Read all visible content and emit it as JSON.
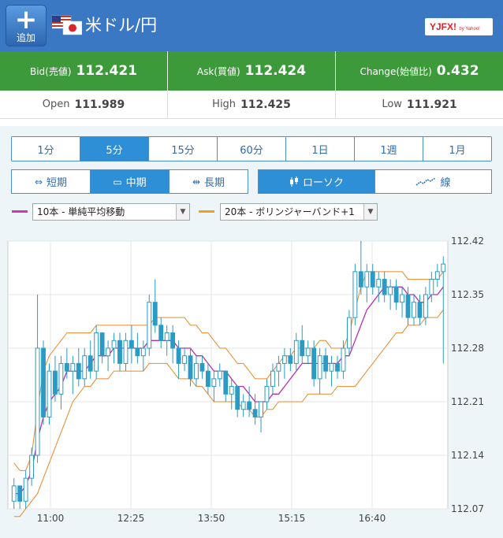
{
  "header": {
    "add_label": "追加",
    "pair_title": "米ドル/円",
    "logo_text": "YJFX!",
    "logo_sub": "by Yahoo!"
  },
  "prices": {
    "bid_label": "Bid(売値)",
    "bid_main": "112.42",
    "bid_last": "1",
    "ask_label": "Ask(買値)",
    "ask_main": "112.42",
    "ask_last": "4",
    "change_label": "Change(始値比)",
    "change_value": "0.432"
  },
  "ohl": {
    "open_label": "Open",
    "open_value": "111.989",
    "high_label": "High",
    "high_value": "112.425",
    "low_label": "Low",
    "low_value": "111.921"
  },
  "timeframes": [
    "1分",
    "5分",
    "15分",
    "60分",
    "1日",
    "1週",
    "1月"
  ],
  "active_timeframe": 1,
  "periods": [
    {
      "label": "短期",
      "icon": "↔"
    },
    {
      "label": "中期",
      "icon": "▭"
    },
    {
      "label": "長期",
      "icon": "↔"
    }
  ],
  "active_period": 1,
  "chart_types": [
    {
      "label": "ローソク",
      "icon": "candle-icon"
    },
    {
      "label": "線",
      "icon": "line-icon"
    }
  ],
  "active_chart_type": 0,
  "indicators": {
    "ind1": {
      "label": "10本 - 単純平均移動",
      "color": "#c43bb5"
    },
    "ind2": {
      "label": "20本 - ボリンジャーバンド+1",
      "color": "#f0a020"
    }
  },
  "colors": {
    "header": "#3b78c4",
    "price_bar": "#3c9a3a",
    "active_tab": "#2f8fd6",
    "candle": "#2a9bc4",
    "ma": "#b72fb0",
    "band": "#e8892a"
  },
  "chart_data": {
    "type": "candlestick",
    "x_tick_labels": [
      "11:00",
      "12:25",
      "13:50",
      "15:15",
      "16:40"
    ],
    "y_tick_labels": [
      "112.42",
      "112.35",
      "112.28",
      "112.21",
      "112.14",
      "112.07"
    ],
    "ylim": [
      112.07,
      112.42
    ],
    "grid": true,
    "candles": [
      [
        112.08,
        112.11,
        112.07,
        112.1
      ],
      [
        112.1,
        112.1,
        112.07,
        112.08
      ],
      [
        112.08,
        112.12,
        112.07,
        112.11
      ],
      [
        112.11,
        112.15,
        112.1,
        112.14
      ],
      [
        112.14,
        112.35,
        112.13,
        112.28
      ],
      [
        112.28,
        112.29,
        112.18,
        112.19
      ],
      [
        112.19,
        112.26,
        112.18,
        112.25
      ],
      [
        112.25,
        112.27,
        112.21,
        112.22
      ],
      [
        112.22,
        112.27,
        112.2,
        112.26
      ],
      [
        112.26,
        112.28,
        112.24,
        112.25
      ],
      [
        112.25,
        112.27,
        112.22,
        112.26
      ],
      [
        112.26,
        112.28,
        112.23,
        112.24
      ],
      [
        112.24,
        112.28,
        112.23,
        112.27
      ],
      [
        112.27,
        112.29,
        112.24,
        112.25
      ],
      [
        112.25,
        112.31,
        112.24,
        112.3
      ],
      [
        112.3,
        112.3,
        112.26,
        112.27
      ],
      [
        112.27,
        112.29,
        112.25,
        112.28
      ],
      [
        112.28,
        112.3,
        112.26,
        112.29
      ],
      [
        112.29,
        112.3,
        112.25,
        112.26
      ],
      [
        112.26,
        112.3,
        112.25,
        112.29
      ],
      [
        112.29,
        112.31,
        112.26,
        112.28
      ],
      [
        112.28,
        112.3,
        112.26,
        112.27
      ],
      [
        112.27,
        112.29,
        112.25,
        112.28
      ],
      [
        112.28,
        112.35,
        112.27,
        112.34
      ],
      [
        112.34,
        112.37,
        112.3,
        112.31
      ],
      [
        112.31,
        112.32,
        112.28,
        112.29
      ],
      [
        112.29,
        112.31,
        112.27,
        112.3
      ],
      [
        112.3,
        112.31,
        112.26,
        112.28
      ],
      [
        112.28,
        112.29,
        112.24,
        112.26
      ],
      [
        112.26,
        112.28,
        112.25,
        112.27
      ],
      [
        112.27,
        112.28,
        112.23,
        112.24
      ],
      [
        112.24,
        112.27,
        112.23,
        112.26
      ],
      [
        112.26,
        112.27,
        112.24,
        112.25
      ],
      [
        112.25,
        112.26,
        112.22,
        112.23
      ],
      [
        112.23,
        112.25,
        112.21,
        112.24
      ],
      [
        112.24,
        112.26,
        112.23,
        112.25
      ],
      [
        112.25,
        112.25,
        112.21,
        112.22
      ],
      [
        112.22,
        112.24,
        112.2,
        112.23
      ],
      [
        112.23,
        112.23,
        112.19,
        112.2
      ],
      [
        112.2,
        112.22,
        112.19,
        112.21
      ],
      [
        112.21,
        112.23,
        112.19,
        112.2
      ],
      [
        112.2,
        112.22,
        112.18,
        112.19
      ],
      [
        112.19,
        112.21,
        112.17,
        112.21
      ],
      [
        112.21,
        112.24,
        112.2,
        112.23
      ],
      [
        112.23,
        112.26,
        112.22,
        112.25
      ],
      [
        112.25,
        112.27,
        112.23,
        112.26
      ],
      [
        112.26,
        112.28,
        112.24,
        112.27
      ],
      [
        112.27,
        112.28,
        112.25,
        112.26
      ],
      [
        112.26,
        112.3,
        112.25,
        112.29
      ],
      [
        112.29,
        112.31,
        112.26,
        112.27
      ],
      [
        112.27,
        112.29,
        112.26,
        112.28
      ],
      [
        112.28,
        112.29,
        112.23,
        112.24
      ],
      [
        112.24,
        112.28,
        112.22,
        112.27
      ],
      [
        112.27,
        112.28,
        112.24,
        112.25
      ],
      [
        112.25,
        112.27,
        112.23,
        112.26
      ],
      [
        112.26,
        112.27,
        112.24,
        112.25
      ],
      [
        112.25,
        112.29,
        112.24,
        112.28
      ],
      [
        112.28,
        112.33,
        112.27,
        112.32
      ],
      [
        112.32,
        112.39,
        112.31,
        112.38
      ],
      [
        112.38,
        112.42,
        112.35,
        112.36
      ],
      [
        112.36,
        112.39,
        112.34,
        112.38
      ],
      [
        112.38,
        112.39,
        112.35,
        112.36
      ],
      [
        112.36,
        112.38,
        112.34,
        112.37
      ],
      [
        112.37,
        112.38,
        112.34,
        112.35
      ],
      [
        112.35,
        112.37,
        112.33,
        112.36
      ],
      [
        112.36,
        112.37,
        112.33,
        112.34
      ],
      [
        112.34,
        112.36,
        112.32,
        112.35
      ],
      [
        112.35,
        112.36,
        112.31,
        112.32
      ],
      [
        112.32,
        112.35,
        112.31,
        112.34
      ],
      [
        112.34,
        112.35,
        112.31,
        112.32
      ],
      [
        112.32,
        112.36,
        112.31,
        112.35
      ],
      [
        112.35,
        112.38,
        112.34,
        112.37
      ],
      [
        112.37,
        112.39,
        112.36,
        112.38
      ],
      [
        112.38,
        112.4,
        112.26,
        112.39
      ]
    ],
    "series": [
      {
        "name": "10本 - 単純平均移動",
        "values": [
          112.09,
          112.09,
          112.1,
          112.12,
          112.16,
          112.19,
          112.21,
          112.22,
          112.23,
          112.25,
          112.25,
          112.25,
          112.25,
          112.26,
          112.27,
          112.27,
          112.27,
          112.28,
          112.28,
          112.28,
          112.28,
          112.28,
          112.28,
          112.29,
          112.29,
          112.29,
          112.29,
          112.29,
          112.28,
          112.28,
          112.28,
          112.27,
          112.27,
          112.26,
          112.25,
          112.25,
          112.25,
          112.24,
          112.23,
          112.23,
          112.22,
          112.21,
          112.21,
          112.21,
          112.22,
          112.22,
          112.23,
          112.24,
          112.25,
          112.26,
          112.26,
          112.26,
          112.26,
          112.26,
          112.26,
          112.26,
          112.27,
          112.27,
          112.29,
          112.31,
          112.33,
          112.34,
          112.35,
          112.36,
          112.36,
          112.36,
          112.36,
          112.35,
          112.35,
          112.34,
          112.34,
          112.35,
          112.35,
          112.36
        ]
      },
      {
        "name": "BB+1",
        "values": [
          112.13,
          112.12,
          112.12,
          112.14,
          112.2,
          112.25,
          112.27,
          112.28,
          112.29,
          112.3,
          112.3,
          112.3,
          112.3,
          112.3,
          112.31,
          112.31,
          112.31,
          112.31,
          112.31,
          112.31,
          112.31,
          112.31,
          112.31,
          112.31,
          112.32,
          112.32,
          112.32,
          112.32,
          112.32,
          112.32,
          112.31,
          112.31,
          112.3,
          112.3,
          112.29,
          112.28,
          112.28,
          112.27,
          112.26,
          112.26,
          112.25,
          112.24,
          112.24,
          112.24,
          112.25,
          112.26,
          112.27,
          112.27,
          112.28,
          112.28,
          112.28,
          112.28,
          112.29,
          112.29,
          112.28,
          112.28,
          112.28,
          112.3,
          112.33,
          112.36,
          112.38,
          112.38,
          112.38,
          112.38,
          112.38,
          112.38,
          112.38,
          112.37,
          112.37,
          112.37,
          112.37,
          112.37,
          112.37,
          112.38
        ]
      },
      {
        "name": "BB-1",
        "values": [
          112.06,
          112.06,
          112.07,
          112.08,
          112.09,
          112.11,
          112.13,
          112.15,
          112.17,
          112.19,
          112.21,
          112.22,
          112.23,
          112.23,
          112.24,
          112.24,
          112.24,
          112.25,
          112.25,
          112.25,
          112.25,
          112.25,
          112.25,
          112.26,
          112.26,
          112.26,
          112.26,
          112.25,
          112.24,
          112.24,
          112.24,
          112.23,
          112.23,
          112.22,
          112.21,
          112.21,
          112.21,
          112.21,
          112.21,
          112.2,
          112.2,
          112.19,
          112.19,
          112.2,
          112.2,
          112.21,
          112.21,
          112.21,
          112.21,
          112.21,
          112.22,
          112.22,
          112.22,
          112.22,
          112.22,
          112.23,
          112.23,
          112.23,
          112.23,
          112.24,
          112.25,
          112.26,
          112.27,
          112.28,
          112.29,
          112.3,
          112.3,
          112.31,
          112.31,
          112.31,
          112.32,
          112.32,
          112.32,
          112.33
        ]
      }
    ]
  }
}
